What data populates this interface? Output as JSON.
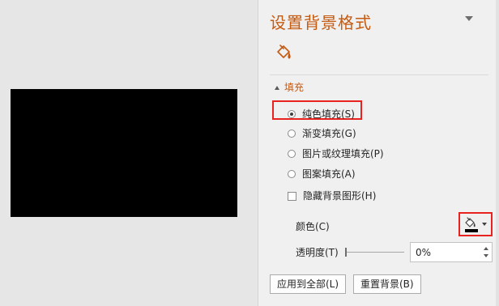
{
  "pane": {
    "title": "设置背景格式",
    "tab_icon": "paint-bucket-icon",
    "section": {
      "label": "填充",
      "expanded": true
    },
    "fill_options": [
      {
        "label": "纯色填充(S)",
        "selected": true
      },
      {
        "label": "渐变填充(G)",
        "selected": false
      },
      {
        "label": "图片或纹理填充(P)",
        "selected": false
      },
      {
        "label": "图案填充(A)",
        "selected": false
      }
    ],
    "hide_background_graphics": {
      "label": "隐藏背景图形(H)",
      "checked": false
    },
    "color": {
      "label": "颜色(C)",
      "value": "#000000",
      "icon": "paint-bucket-icon"
    },
    "transparency": {
      "label": "透明度(T)",
      "value": "0%",
      "level": 0
    },
    "buttons": {
      "apply_all": "应用到全部(L)",
      "reset": "重置背景(B)"
    }
  },
  "slide": {
    "background_color": "#000000"
  },
  "colors": {
    "accent": "#c55a11",
    "highlight": "#e8231f",
    "pane_background": "#f0f0f0",
    "workspace_background": "#e6e6e6"
  }
}
